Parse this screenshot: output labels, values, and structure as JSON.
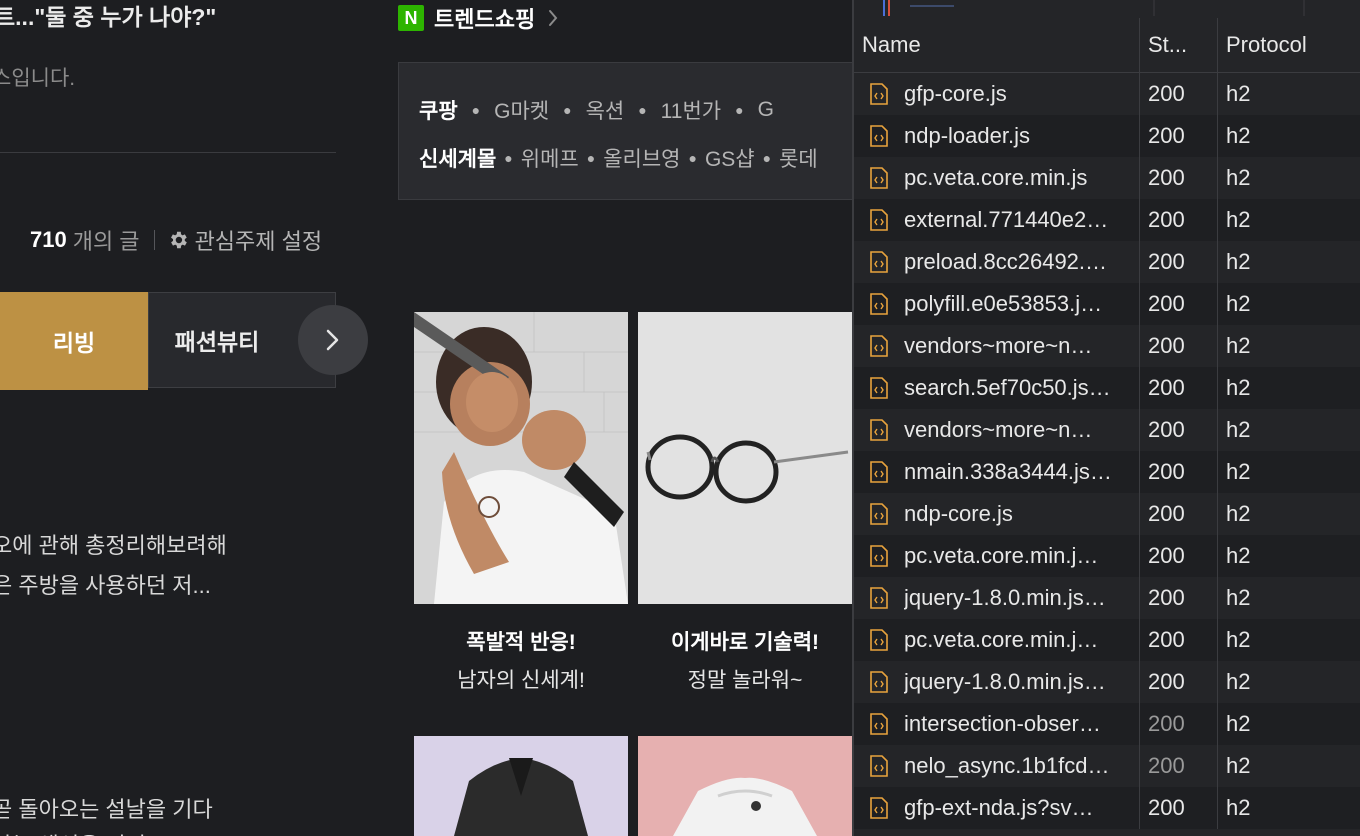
{
  "left": {
    "headline": "트...\"둘 중 누가 나야?\"",
    "subtext": "스입니다.",
    "post_count": "710",
    "post_count_unit": "개의 글",
    "interest_settings": "관심주제 설정",
    "tabs": [
      {
        "label": "리빙",
        "active": true
      },
      {
        "label": "패션뷰티",
        "active": false
      }
    ],
    "articles": [
      "오에 관해 총정리해보려해",
      "은 주방을 사용하던 저...",
      "곧 돌아오는 설날을 기다",
      "아는 생선을 먹어"
    ]
  },
  "trend": {
    "logo": "N",
    "title": "트렌드쇼핑",
    "shop_row1": [
      "쿠팡",
      "G마켓",
      "옥션",
      "11번가",
      "G"
    ],
    "shop_row2": [
      "신세계몰",
      "위메프",
      "올리브영",
      "GS샵",
      "롯데"
    ],
    "products": [
      {
        "title": "폭발적 반응!",
        "subtitle": "남자의 신세계!"
      },
      {
        "title": "이게바로 기술력!",
        "subtitle": "정말 놀라워~"
      }
    ]
  },
  "devtools": {
    "columns": {
      "name": "Name",
      "status": "St...",
      "protocol": "Protocol"
    },
    "requests": [
      {
        "name": "gfp-core.js",
        "status": "200",
        "protocol": "h2",
        "dim": false
      },
      {
        "name": "ndp-loader.js",
        "status": "200",
        "protocol": "h2",
        "dim": false
      },
      {
        "name": "pc.veta.core.min.js",
        "status": "200",
        "protocol": "h2",
        "dim": false
      },
      {
        "name": "external.771440e2…",
        "status": "200",
        "protocol": "h2",
        "dim": false
      },
      {
        "name": "preload.8cc26492.…",
        "status": "200",
        "protocol": "h2",
        "dim": false
      },
      {
        "name": "polyfill.e0e53853.j…",
        "status": "200",
        "protocol": "h2",
        "dim": false
      },
      {
        "name": "vendors~more~n…",
        "status": "200",
        "protocol": "h2",
        "dim": false
      },
      {
        "name": "search.5ef70c50.js…",
        "status": "200",
        "protocol": "h2",
        "dim": false
      },
      {
        "name": "vendors~more~n…",
        "status": "200",
        "protocol": "h2",
        "dim": false
      },
      {
        "name": "nmain.338a3444.js…",
        "status": "200",
        "protocol": "h2",
        "dim": false
      },
      {
        "name": "ndp-core.js",
        "status": "200",
        "protocol": "h2",
        "dim": false
      },
      {
        "name": "pc.veta.core.min.j…",
        "status": "200",
        "protocol": "h2",
        "dim": false
      },
      {
        "name": "jquery-1.8.0.min.js…",
        "status": "200",
        "protocol": "h2",
        "dim": false
      },
      {
        "name": "pc.veta.core.min.j…",
        "status": "200",
        "protocol": "h2",
        "dim": false
      },
      {
        "name": "jquery-1.8.0.min.js…",
        "status": "200",
        "protocol": "h2",
        "dim": false
      },
      {
        "name": "intersection-obser…",
        "status": "200",
        "protocol": "h2",
        "dim": true
      },
      {
        "name": "nelo_async.1b1fcd…",
        "status": "200",
        "protocol": "h2",
        "dim": true
      },
      {
        "name": "gfp-ext-nda.js?sv…",
        "status": "200",
        "protocol": "h2",
        "dim": false
      }
    ]
  },
  "colors": {
    "accent_gold": "#bd9144",
    "naver_green": "#2db400",
    "file_icon_orange": "#e8a33d",
    "background": "#1d1e21"
  }
}
